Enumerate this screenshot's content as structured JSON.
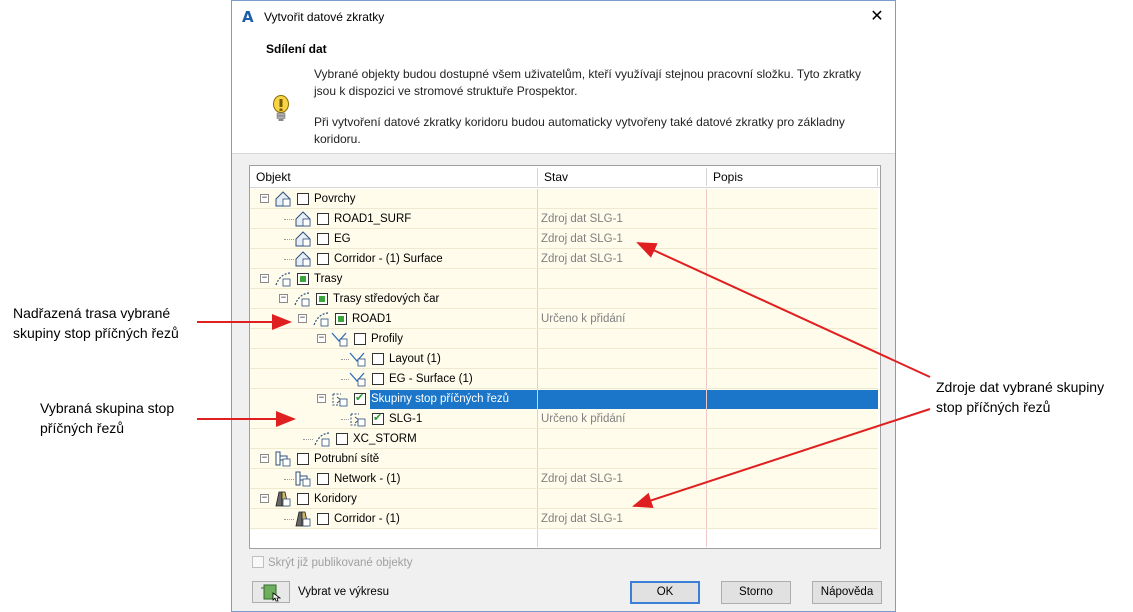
{
  "annotations": {
    "parent_line": [
      "Nadřazená trasa vybrané",
      "skupiny stop příčných řezů"
    ],
    "selected_group": [
      "Vybraná skupina stop",
      "příčných řezů"
    ],
    "data_sources": [
      "Zdroje dat vybrané skupiny",
      "stop příčných řezů"
    ]
  },
  "dialog": {
    "title": "Vytvořit datové zkratky",
    "header_title": "Sdílení dat",
    "para1": "Vybrané objekty budou dostupné všem uživatelům, kteří využívají stejnou pracovní složku. Tyto zkratky jsou k dispozici ve stromové struktuře Prospektor.",
    "para2": "Při vytvoření datové zkratky koridoru budou automaticky vytvořeny také datové zkratky pro základny koridoru."
  },
  "grid": {
    "columns": [
      "Objekt",
      "Stav",
      "Popis"
    ],
    "rows": [
      {
        "label": "Povrchy",
        "status": ""
      },
      {
        "label": "ROAD1_SURF",
        "status": "Zdroj dat SLG-1"
      },
      {
        "label": "EG",
        "status": "Zdroj dat SLG-1"
      },
      {
        "label": "Corridor - (1) Surface",
        "status": "Zdroj dat SLG-1"
      },
      {
        "label": "Trasy",
        "status": ""
      },
      {
        "label": "Trasy středových čar",
        "status": ""
      },
      {
        "label": "ROAD1",
        "status": "Určeno k přidání"
      },
      {
        "label": "Profily",
        "status": ""
      },
      {
        "label": "Layout (1)",
        "status": ""
      },
      {
        "label": "EG - Surface (1)",
        "status": ""
      },
      {
        "label": "Skupiny stop příčných řezů",
        "status": ""
      },
      {
        "label": "SLG-1",
        "status": "Určeno k přidání"
      },
      {
        "label": "XC_STORM",
        "status": ""
      },
      {
        "label": "Potrubní sítě",
        "status": ""
      },
      {
        "label": "Network - (1)",
        "status": "Zdroj dat SLG-1"
      },
      {
        "label": "Koridory",
        "status": ""
      },
      {
        "label": "Corridor - (1)",
        "status": "Zdroj dat SLG-1"
      }
    ]
  },
  "footer": {
    "hide_published": "Skrýt již publikované objekty",
    "pick_in_drawing": "Vybrat ve výkresu",
    "ok": "OK",
    "cancel": "Storno",
    "help": "Nápověda"
  }
}
